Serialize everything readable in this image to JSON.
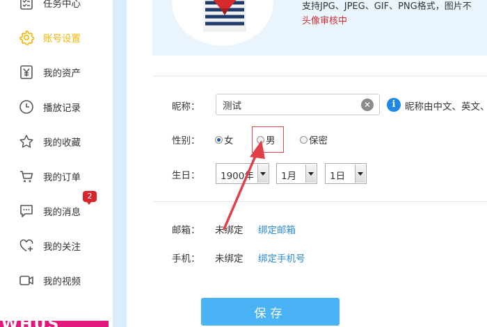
{
  "sidebar": {
    "items": [
      {
        "label": "任务中心",
        "icon": "task-list-icon"
      },
      {
        "label": "账号设置",
        "icon": "gear-icon",
        "active": true
      },
      {
        "label": "我的资产",
        "icon": "yen-icon"
      },
      {
        "label": "播放记录",
        "icon": "clock-icon"
      },
      {
        "label": "我的收藏",
        "icon": "star-icon"
      },
      {
        "label": "我的订单",
        "icon": "cart-icon"
      },
      {
        "label": "我的消息",
        "icon": "message-icon",
        "badge": "2"
      },
      {
        "label": "我的关注",
        "icon": "heart-plus-icon"
      },
      {
        "label": "我的视频",
        "icon": "video-icon"
      }
    ],
    "logo_text": "WHUS"
  },
  "avatar": {
    "tip": "支持JPG、JPEG、GIF、PNG格式，图片不",
    "review": "头像审核中"
  },
  "form": {
    "nickname_label": "昵称：",
    "nickname_value": "测试",
    "nickname_hint": "昵称由中文、英文、",
    "gender_label": "性别：",
    "gender_options": [
      "女",
      "男",
      "保密"
    ],
    "gender_selected": "女",
    "birthday_label": "生日：",
    "birthday_year": "1900年",
    "birthday_month": "1月",
    "birthday_day": "1日",
    "email_label": "邮箱：",
    "email_status": "未绑定",
    "email_link": "绑定邮箱",
    "phone_label": "手机：",
    "phone_status": "未绑定",
    "phone_link": "绑定手机号",
    "save_label": "保存"
  },
  "colors": {
    "active": "#f2b600",
    "link": "#2a8ad4",
    "save_button": "#4ab3f6",
    "annotation": "#e0404a",
    "badge": "#d9262c"
  }
}
